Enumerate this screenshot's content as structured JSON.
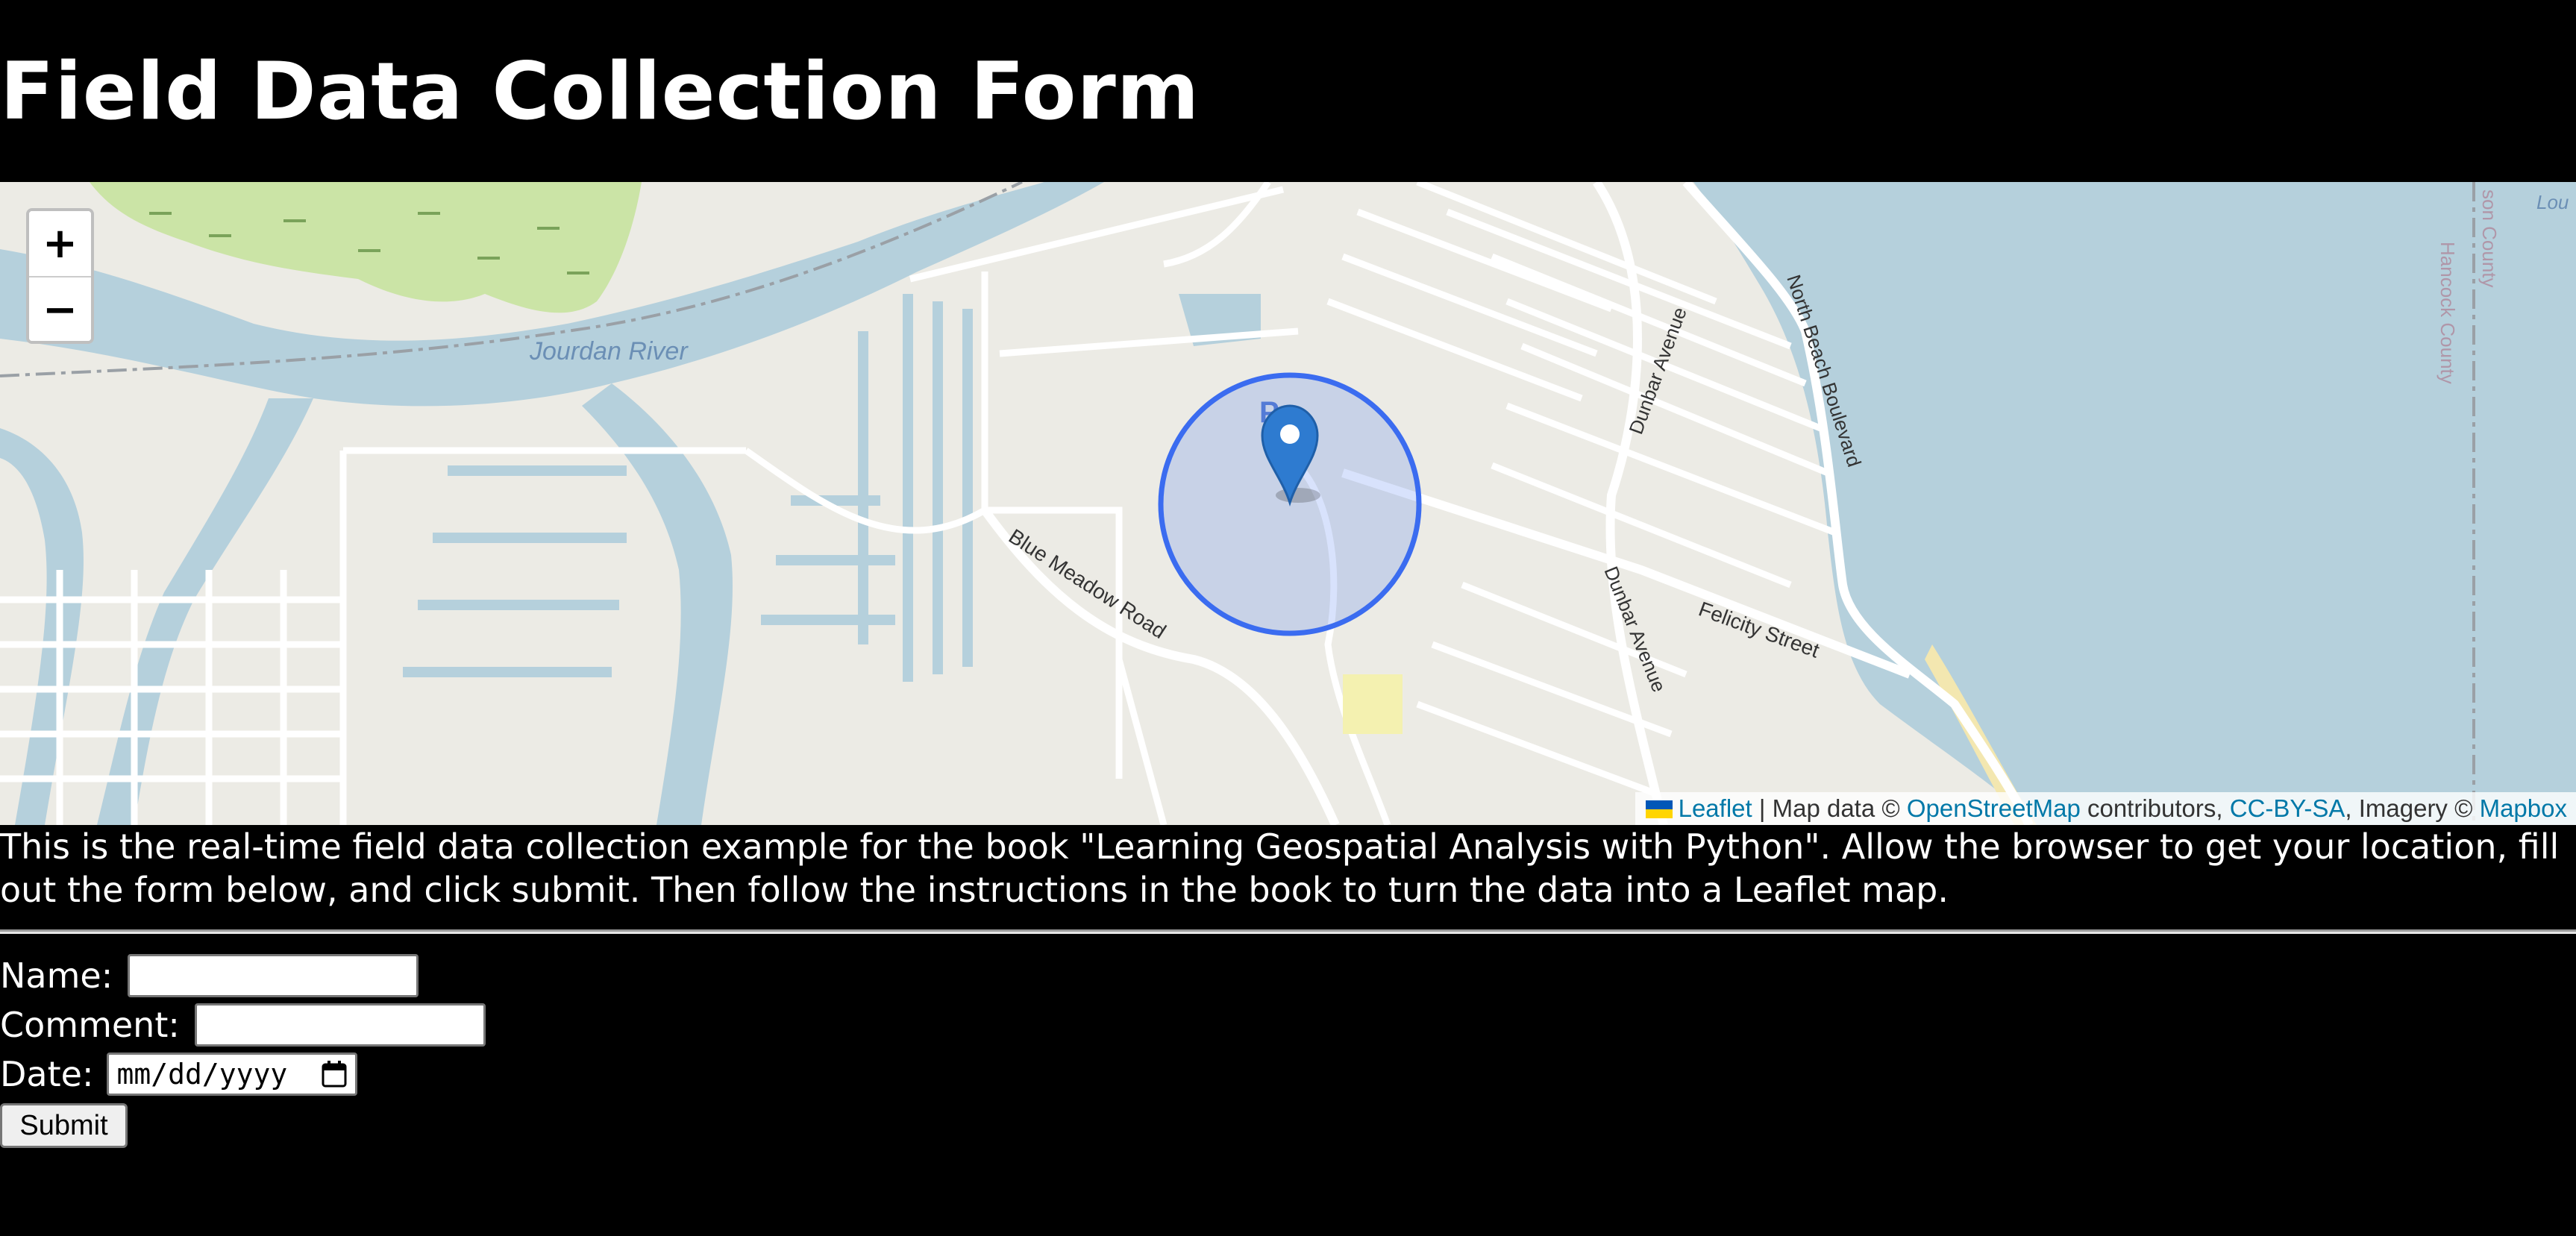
{
  "page": {
    "title": "Field Data Collection Form",
    "intro": "This is the real-time field data collection example for the book \"Learning Geospatial Analysis with Python\". Allow the browser to get your location, fill out the form below, and click submit. Then follow the instructions in the book to turn the data into a Leaflet map."
  },
  "map": {
    "zoom_in_label": "+",
    "zoom_out_label": "−",
    "labels": {
      "river": "Jourdan River",
      "blue_meadow": "Blue Meadow Road",
      "dunbar_upper": "Dunbar Avenue",
      "dunbar_lower": "Dunbar Avenue",
      "north_beach": "North Beach Boulevard",
      "felicity": "Felicity Street",
      "hancock": "Hancock County",
      "county_partial": "son County",
      "corner_partial": "Lou",
      "parking": "P"
    },
    "attribution": {
      "leaflet": "Leaflet",
      "sep1": " | Map data © ",
      "osm": "OpenStreetMap",
      "contributors": " contributors, ",
      "license": "CC-BY-SA",
      "imagery": ", Imagery © ",
      "provider": "Mapbox"
    },
    "colors": {
      "water": "#b5d0dc",
      "land": "#ecebe5",
      "wetland": "#cbe4a6",
      "accuracy_circle": "#3b6cf0",
      "marker": "#2e7bd0"
    }
  },
  "form": {
    "name_label": "Name:",
    "name_value": "",
    "comment_label": "Comment:",
    "comment_value": "",
    "date_label": "Date:",
    "date_placeholder": "mm/dd/yyyy",
    "submit_label": "Submit",
    "calendar_icon": "calendar-icon"
  }
}
